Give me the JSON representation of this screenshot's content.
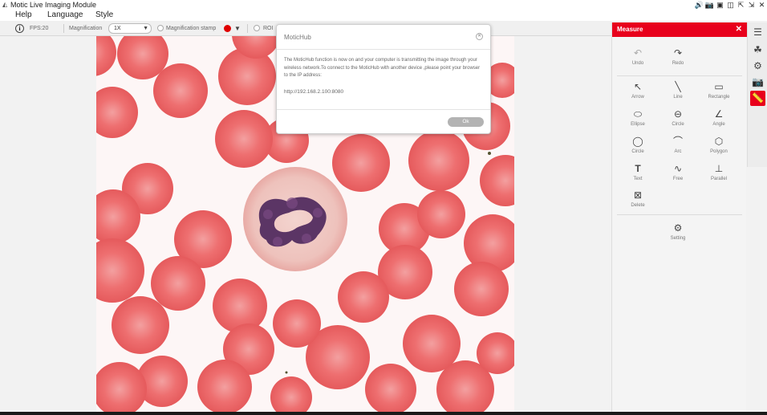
{
  "window": {
    "title": "Motic Live Imaging Module",
    "controls": [
      "🔊",
      "📷",
      "▣",
      "◫",
      "⇱",
      "⇲",
      "✕"
    ]
  },
  "menu": {
    "items": [
      "Help",
      "Language",
      "Style"
    ]
  },
  "toolbar": {
    "fps": "FPS:20",
    "magnification_label": "Magnification",
    "magnification_value": "1X",
    "magnification_stamp_label": "Magnification stamp",
    "roi_label": "ROI",
    "stamp_color": "#e00000"
  },
  "dialog": {
    "title": "MoticHub",
    "message": "The MoticHub function is now on and your computer is transmitting the image through your wireless network.To connect to the MoticHub with another device ,please point your browser to the IP address:",
    "ip": "http://192.168.2.100:8080",
    "ok_label": "Ok"
  },
  "measure_panel": {
    "title": "Measure",
    "accent": "#e8001c",
    "undo_label": "Undo",
    "redo_label": "Redo",
    "tools": [
      {
        "label": "Arrow",
        "icon": "arrow-icon",
        "glyph": "↖"
      },
      {
        "label": "Line",
        "icon": "line-icon",
        "glyph": "╲"
      },
      {
        "label": "Rectangle",
        "icon": "rectangle-icon",
        "glyph": "▭"
      },
      {
        "label": "Ellipse",
        "icon": "ellipse-icon",
        "glyph": "⬭"
      },
      {
        "label": "Circle",
        "icon": "circle-icon",
        "glyph": "⊖"
      },
      {
        "label": "Angle",
        "icon": "angle-icon",
        "glyph": "∠"
      },
      {
        "label": "Circle",
        "icon": "circle-3pt-icon",
        "glyph": "◯"
      },
      {
        "label": "Arc",
        "icon": "arc-icon",
        "glyph": "⌒"
      },
      {
        "label": "Polygon",
        "icon": "polygon-icon",
        "glyph": "⬡"
      },
      {
        "label": "Text",
        "icon": "text-icon",
        "glyph": "T"
      },
      {
        "label": "Free",
        "icon": "freehand-icon",
        "glyph": "∿"
      },
      {
        "label": "Parallel",
        "icon": "parallel-icon",
        "glyph": "⊥"
      }
    ],
    "delete_label": "Delete",
    "setting_label": "Setting"
  },
  "sidebar": {
    "buttons": [
      {
        "name": "adjust-icon",
        "glyph": "☰"
      },
      {
        "name": "color-icon",
        "glyph": "☘"
      },
      {
        "name": "gears-icon",
        "glyph": "⚙"
      },
      {
        "name": "camera-icon",
        "glyph": "📷"
      },
      {
        "name": "ruler-icon",
        "glyph": "📏"
      }
    ]
  }
}
